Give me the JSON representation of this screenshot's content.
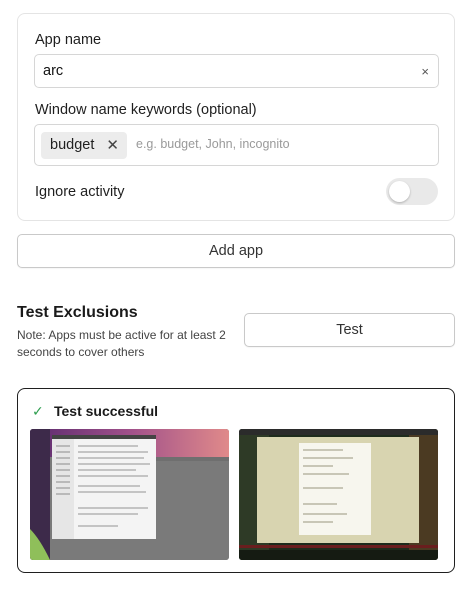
{
  "form": {
    "app_name_label": "App name",
    "app_name_value": "arc",
    "clear_glyph": "×",
    "keywords_label": "Window name keywords (optional)",
    "keyword_chips": [
      "budget"
    ],
    "chip_remove_glyph": "✕",
    "keywords_placeholder": "e.g. budget, John, incognito",
    "ignore_label": "Ignore activity",
    "ignore_activity": false
  },
  "add_app_label": "Add app",
  "test_section": {
    "title": "Test Exclusions",
    "note": "Note: Apps must be active for at least 2 seconds to cover others",
    "test_label": "Test"
  },
  "result": {
    "check_glyph": "✓",
    "status_text": "Test successful",
    "icon": "check-icon"
  },
  "colors": {
    "success": "#2e9e4f",
    "toggle_off": "#e9e9e9",
    "border": "#e4e4e4"
  }
}
